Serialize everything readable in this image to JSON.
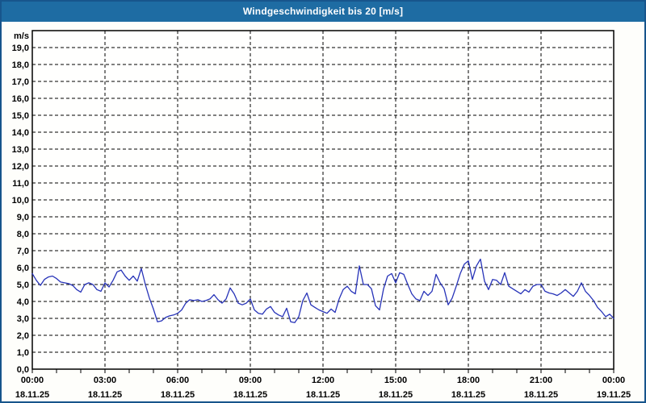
{
  "window": {
    "title": "Windgeschwindigkeit bis 20 [m/s]"
  },
  "colors": {
    "title_bar": "#1E6CA3",
    "title_text": "#FFFFFF",
    "frame_border": "#17558C",
    "plot_background": "#FFFFFE",
    "grid": "#000000",
    "axis": "#000000",
    "label": "#000000",
    "line": "#2733B8"
  },
  "chart_data": {
    "type": "line",
    "title": "Windgeschwindigkeit bis 20 [m/s]",
    "ylabel": "m/s",
    "ylim": [
      0,
      20
    ],
    "y_tick_step": 1.0,
    "y_tick_labels": [
      "0,0",
      "1,0",
      "2,0",
      "3,0",
      "4,0",
      "5,0",
      "6,0",
      "7,0",
      "8,0",
      "9,0",
      "10,0",
      "11,0",
      "12,0",
      "13,0",
      "14,0",
      "15,0",
      "16,0",
      "17,0",
      "18,0",
      "19,0"
    ],
    "x_range_hours": [
      0,
      24
    ],
    "x_minor_tick_hours": 1,
    "x_major_tick_hours": 3,
    "x_ticks": [
      {
        "time": "00:00",
        "date": "18.11.25"
      },
      {
        "time": "03:00",
        "date": "18.11.25"
      },
      {
        "time": "06:00",
        "date": "18.11.25"
      },
      {
        "time": "09:00",
        "date": "18.11.25"
      },
      {
        "time": "12:00",
        "date": "18.11.25"
      },
      {
        "time": "15:00",
        "date": "18.11.25"
      },
      {
        "time": "18:00",
        "date": "18.11.25"
      },
      {
        "time": "21:00",
        "date": "18.11.25"
      },
      {
        "time": "00:00",
        "date": "19.11.25"
      }
    ],
    "grid": "dashed",
    "legend": "none",
    "series": [
      {
        "name": "Windgeschwindigkeit",
        "interval_minutes": 10,
        "values": [
          5.65,
          5.25,
          4.95,
          5.3,
          5.45,
          5.5,
          5.35,
          5.15,
          5.1,
          5.05,
          4.95,
          4.7,
          4.55,
          5.0,
          5.1,
          5.0,
          4.7,
          4.6,
          5.1,
          4.85,
          5.25,
          5.75,
          5.85,
          5.5,
          5.25,
          5.5,
          5.2,
          5.95,
          5.0,
          4.2,
          3.55,
          2.8,
          2.85,
          3.05,
          3.15,
          3.2,
          3.3,
          3.5,
          3.9,
          4.1,
          4.05,
          4.1,
          4.0,
          4.05,
          4.15,
          4.4,
          4.1,
          3.9,
          4.15,
          4.8,
          4.45,
          3.9,
          3.8,
          3.9,
          4.15,
          3.5,
          3.3,
          3.25,
          3.55,
          3.7,
          3.35,
          3.2,
          3.1,
          3.6,
          2.8,
          2.75,
          3.1,
          4.05,
          4.5,
          3.8,
          3.65,
          3.5,
          3.4,
          3.3,
          3.55,
          3.35,
          4.15,
          4.7,
          4.9,
          4.6,
          4.45,
          6.1,
          5.0,
          5.0,
          4.75,
          3.75,
          3.5,
          4.75,
          5.5,
          5.65,
          5.1,
          5.7,
          5.6,
          5.0,
          4.45,
          4.15,
          4.05,
          4.6,
          4.35,
          4.6,
          5.6,
          5.1,
          4.75,
          3.8,
          4.2,
          4.9,
          5.65,
          6.2,
          6.4,
          5.3,
          6.1,
          6.5,
          5.2,
          4.7,
          5.3,
          5.25,
          5.0,
          5.7,
          4.9,
          4.75,
          4.6,
          4.45,
          4.7,
          4.55,
          4.9,
          5.0,
          5.0,
          4.6,
          4.5,
          4.45,
          4.35,
          4.5,
          4.7,
          4.5,
          4.3,
          4.6,
          5.1,
          4.6,
          4.35,
          4.05,
          3.65,
          3.4,
          3.1,
          3.25,
          3.0
        ]
      }
    ]
  }
}
